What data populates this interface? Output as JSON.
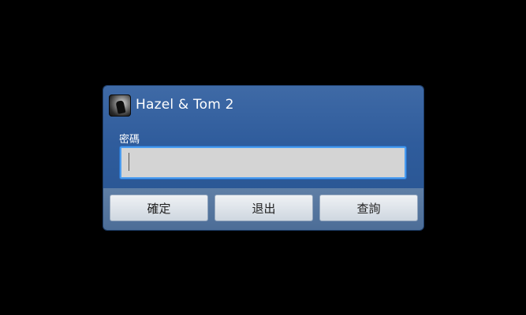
{
  "dialog": {
    "title": "Hazel & Tom 2",
    "app_icon": "app-icon",
    "field_label": "密碼",
    "password": {
      "value": "",
      "placeholder": ""
    },
    "buttons": {
      "ok": "確定",
      "exit": "退出",
      "query": "查詢"
    }
  },
  "colors": {
    "background": "#000000",
    "dialog_blue": "#2f5c9c",
    "input_focus_border": "#4a9cf0",
    "button_bar": "#5073a0"
  }
}
